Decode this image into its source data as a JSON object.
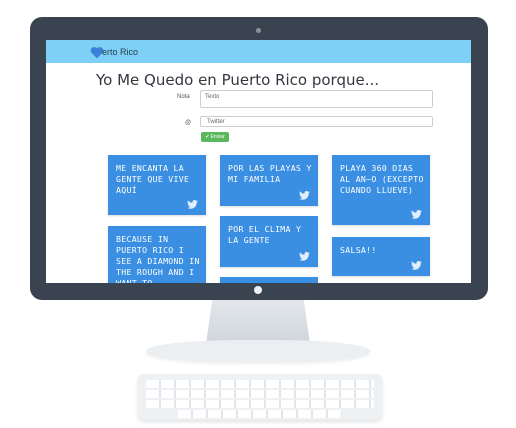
{
  "navbar": {
    "brand_text": "erto Rico"
  },
  "page": {
    "title": "Yo Me Quedo en Puerto Rico porque..."
  },
  "form": {
    "nota_label": "Nota",
    "nota_placeholder": "Texto",
    "twitter_label": "@",
    "twitter_placeholder": "Twitter",
    "submit_label": "Enviar"
  },
  "cards": [
    {
      "text": "ME ENCANTA LA GENTE QUE VIVE AQUÍ"
    },
    {
      "text": "BECAUSE IN PUERTO RICO I SEE A DIAMOND IN THE ROUGH AND I WANT TO"
    },
    {
      "text": "POR LAS PLAYAS Y MI FAMILIA"
    },
    {
      "text": "POR EL CLIMA Y LA GENTE"
    },
    {
      "text": "PLAYA 360 DIAS AL AN~O (EXCEPTO CUANDO LLUEVE)"
    },
    {
      "text": "SALSA!!"
    }
  ],
  "colors": {
    "navbar": "#7fd0f6",
    "card": "#3a8fe3",
    "submit": "#5cb85c",
    "bezel": "#3a4450"
  }
}
